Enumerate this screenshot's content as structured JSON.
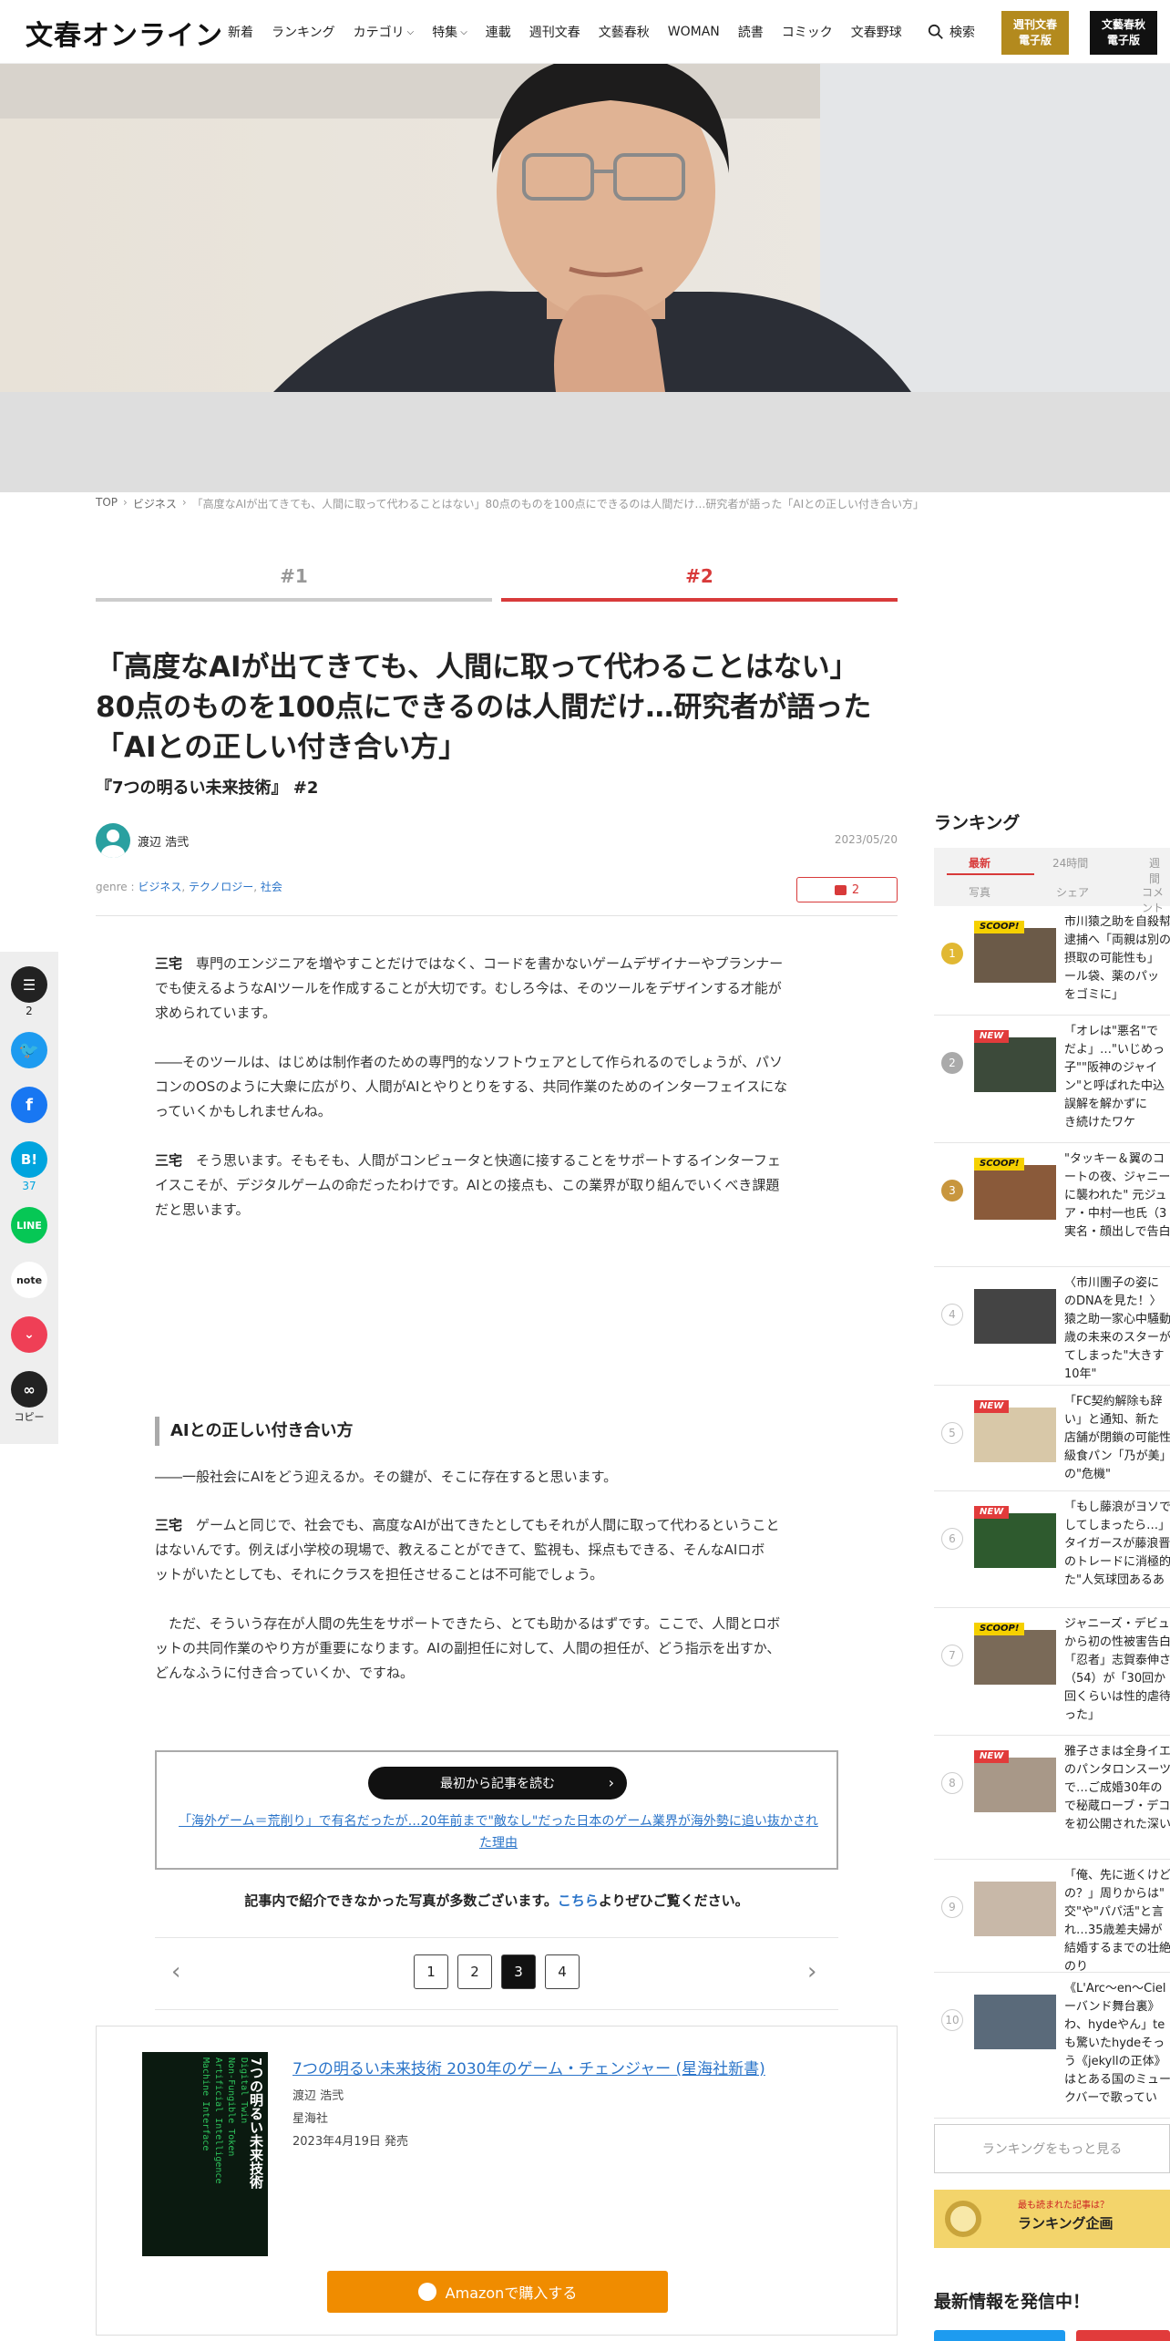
{
  "header": {
    "logo": "文春オンライン",
    "nav": [
      "新着",
      "ランキング",
      "カテゴリ",
      "特集",
      "連載",
      "週刊文春",
      "文藝春秋",
      "WOMAN",
      "読書",
      "コミック",
      "文春野球"
    ],
    "search_label": "検索",
    "ebook_bunshun": [
      "週刊文春",
      "電子版"
    ],
    "ebook_bungei": [
      "文藝春秋",
      "電子版"
    ]
  },
  "breadcrumb": {
    "top": "TOP",
    "category": "ビジネス",
    "current": "「高度なAIが出てきても、人間に取って代わることはない」80点のものを100点にできるのは人間だけ…研究者が語った「AIとの正しい付き合い方」"
  },
  "page_tabs": [
    "#1",
    "#2"
  ],
  "article": {
    "title_lines": [
      "「高度なAIが出てきても、人間に取って代わることはない」",
      "80点のものを100点にできるのは人間だけ…研究者が語った",
      "「AIとの正しい付き合い方」"
    ],
    "subtitle": "『7つの明るい未来技術』 #2",
    "author": "渡辺 浩弐",
    "date": "2023/05/20",
    "genre_label": "genre : ",
    "genres": [
      "ビジネス",
      "テクノロジー",
      "社会"
    ],
    "comment_count": "2",
    "paragraphs": [
      {
        "speaker": "三宅",
        "lines": [
          "専門のエンジニアを増やすことだけではなく、コードを書かないゲームデザイナーやプランナー",
          "でも使えるようなAIツールを作成することが大切です。むしろ今は、そのツールをデザインする才能が",
          "求められています。"
        ]
      },
      {
        "speaker": "",
        "lines": [
          "――そのツールは、はじめは制作者のための専門的なソフトウェアとして作られるのでしょうが、パソ",
          "コンのOSのように大衆に広がり、人間がAIとやりとりをする、共同作業のためのインターフェイスにな",
          "っていくかもしれませんね。"
        ]
      },
      {
        "speaker": "三宅",
        "lines": [
          "そう思います。そもそも、人間がコンピュータと快適に接することをサポートするインターフェ",
          "イスこそが、デジタルゲームの命だったわけです。AIとの接点も、この業界が取り組んでいくべき課題",
          "だと思います。"
        ]
      }
    ],
    "section_heading": "AIとの正しい付き合い方",
    "paragraphs2": [
      {
        "speaker": "",
        "lines": [
          "――一般社会にAIをどう迎えるか。その鍵が、そこに存在すると思います。"
        ]
      },
      {
        "speaker": "三宅",
        "lines": [
          "ゲームと同じで、社会でも、高度なAIが出てきたとしてもそれが人間に取って代わるということ",
          "はないんです。例えば小学校の現場で、教えることができて、監視も、採点もできる、そんなAIロボ",
          "ットがいたとしても、それにクラスを担任させることは不可能でしょう。"
        ]
      },
      {
        "speaker": "",
        "lines": [
          "　ただ、そういう存在が人間の先生をサポートできたら、とても助かるはずです。ここで、人間とロボ",
          "ットの共同作業のやり方が重要になります。AIの副担任に対して、人間の担任が、どう指示を出すか、",
          "どんなふうに付き合っていくか、ですね。"
        ]
      }
    ],
    "read_from_start": "最初から記事を読む",
    "first_article_link": "「海外ゲーム＝荒削り」で有名だったが…20年前まで\"敵なし\"だった日本のゲーム業界が海外勢に追い抜かされた理由",
    "photos_note_before": "記事内で紹介できなかった写真が多数ございます。",
    "photos_note_link": "こちら",
    "photos_note_after": "よりぜひご覧ください。",
    "pages": [
      "1",
      "2",
      "3",
      "4"
    ],
    "current_page": "3"
  },
  "book": {
    "title": "7つの明るい未来技術 2030年のゲーム・チェンジャー (星海社新書)",
    "author": "渡辺 浩弐",
    "publisher": "星海社",
    "release": "2023年4月19日 発売",
    "buy_label": "Amazonで購入する",
    "cover_title": "7つの明るい未来技術",
    "cover_words": [
      "Digital Twin",
      "Non-Fungible Token",
      "Artificial Intelligence",
      "Machine Interface"
    ]
  },
  "share": {
    "comment_count": "2",
    "hatena_count": "37",
    "copy_label": "コピー"
  },
  "sidebar": {
    "ranking_title": "ランキング",
    "tabs_row1": [
      "最新",
      "24時間",
      "週間"
    ],
    "tabs_row2": [
      "写真",
      "シェア",
      "コメント"
    ],
    "items": [
      {
        "rank": "1",
        "badge": "SCOOP!",
        "lines": [
          "市川猿之助を自殺幇",
          "逮捕へ「両親は別の",
          "摂取の可能性も」",
          "ール袋、薬のパッ",
          "をゴミに」"
        ]
      },
      {
        "rank": "2",
        "badge": "NEW",
        "lines": [
          "「オレは\"悪名\"で",
          "だよ」…\"いじめっ",
          "子\"\"阪神のジャイ",
          "ン\"と呼ばれた中込",
          "誤解を解かずに",
          "き続けたワケ"
        ]
      },
      {
        "rank": "3",
        "badge": "SCOOP!",
        "lines": [
          "\"タッキー＆翼のコ",
          "ートの夜、ジャニー",
          "に襲われた\" 元ジュ",
          "ア・中村一也氏（3",
          "実名・顔出しで告白"
        ]
      },
      {
        "rank": "4",
        "badge": "",
        "lines": [
          "〈市川團子の姿に",
          "のDNAを見た！〉",
          "猿之助一家心中騒動",
          "歳の未来のスターが",
          "てしまった\"大きす",
          "10年\""
        ]
      },
      {
        "rank": "5",
        "badge": "NEW",
        "lines": [
          "「FC契約解除も辞",
          "い」と通知、新た",
          "店舗が閉鎖の可能性",
          "級食パン「乃が美」",
          "の\"危機\""
        ]
      },
      {
        "rank": "6",
        "badge": "NEW",
        "lines": [
          "「もし藤浪がヨソで",
          "してしまったら…」",
          "タイガースが藤浪晋",
          "のトレードに消極的",
          "た\"人気球団あるあ"
        ]
      },
      {
        "rank": "7",
        "badge": "SCOOP!",
        "lines": [
          "ジャニーズ・デビュ",
          "から初の性被害告白",
          "「忍者」志賀泰伸さ",
          "（54）が「30回か",
          "回くらいは性的虐待",
          "った」"
        ]
      },
      {
        "rank": "8",
        "badge": "NEW",
        "lines": [
          "雅子さまは全身イエ",
          "のパンタロンスーツ",
          "で…ご成婚30年の",
          "で秘蔵ローブ・デコ",
          "を初公開された深い"
        ]
      },
      {
        "rank": "9",
        "badge": "",
        "lines": [
          "「俺、先に逝くけど",
          "の？」周りからは\"",
          "交\"や\"パパ活\"と言",
          "れ…35歳差夫婦が",
          "結婚するまでの壮絶",
          "のり"
        ]
      },
      {
        "rank": "10",
        "badge": "",
        "lines": [
          "《L'Arc～en～Ciel",
          "ーバンド舞台裏》",
          "わ、hydeやん」te",
          "も驚いたhydeそっ",
          "う《jekyllの正体》",
          "はとある国のミュー",
          "クバーで歌ってい"
        ]
      }
    ],
    "more_label": "ランキングをもっと見る",
    "banner_tag": "最も読まれた記事は？",
    "banner_label": "ランキング企画",
    "latest_title": "最新情報を発信中！"
  }
}
